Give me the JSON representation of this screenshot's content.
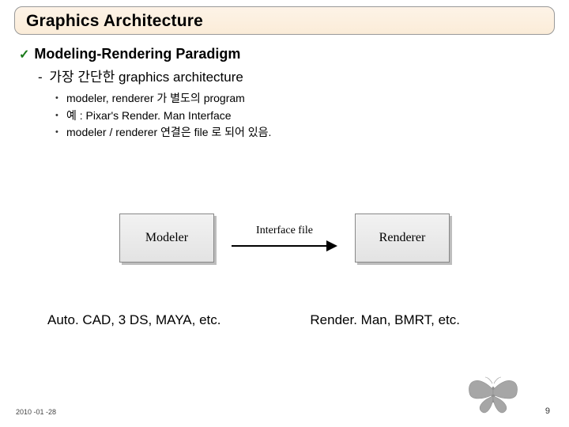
{
  "title": "Graphics Architecture",
  "heading": "Modeling-Rendering Paradigm",
  "subheading_prefix": "-",
  "subheading": "가장 간단한 graphics architecture",
  "bullets": [
    "modeler, renderer 가 별도의 program",
    "예 : Pixar's Render. Man Interface",
    "modeler / renderer 연결은 file 로 되어 있음."
  ],
  "diagram": {
    "left_box": "Modeler",
    "arrow_label": "Interface file",
    "right_box": "Renderer"
  },
  "captions": {
    "left": "Auto. CAD, 3 DS, MAYA, etc.",
    "right": "Render. Man, BMRT, etc."
  },
  "footer": {
    "date": "2010 -01 -28",
    "page": "9"
  }
}
